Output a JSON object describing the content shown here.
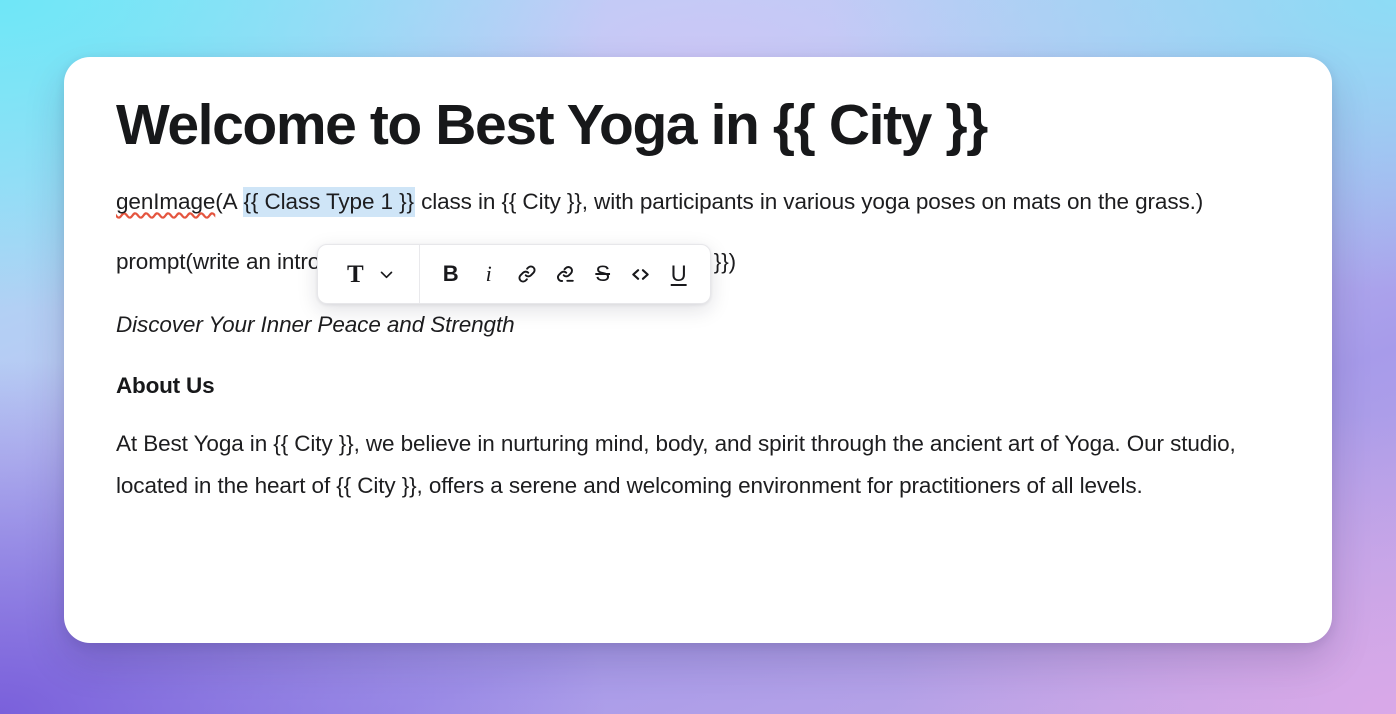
{
  "background": {
    "gradient_colors": [
      "#6fe6f7",
      "#8ddcf5",
      "#cbc7f6",
      "#7a60db",
      "#d9a8e8"
    ]
  },
  "document": {
    "title": "Welcome to Best Yoga in {{ City }}",
    "gen_image_line": {
      "misspelled_word": "genImage",
      "before_selection": "(A ",
      "selected_text": "{{ Class Type 1 }}",
      "after_selection": " class in {{ City }}, with participants in various yoga poses on mats on the grass.)"
    },
    "prompt_line": "prompt(write an introduction about the yoga culture in {{ City }})",
    "tagline": "Discover Your Inner Peace and Strength",
    "about_heading": "About Us",
    "about_body": "At Best Yoga in {{ City }}, we believe in nurturing mind, body, and spirit through the ancient art of Yoga. Our studio, located in the heart of {{ City }}, offers a serene and welcoming environment for practitioners of all levels."
  },
  "toolbar": {
    "text_style_label": "T",
    "dropdown_icon": "chevron-down-icon",
    "buttons": [
      {
        "name": "bold-button",
        "icon": "bold-icon",
        "label": "B"
      },
      {
        "name": "italic-button",
        "icon": "italic-icon",
        "label": "i"
      },
      {
        "name": "link-button",
        "icon": "link-icon",
        "label": ""
      },
      {
        "name": "unlink-button",
        "icon": "link-off-icon",
        "label": ""
      },
      {
        "name": "strikethrough-button",
        "icon": "strikethrough-icon",
        "label": "S"
      },
      {
        "name": "code-button",
        "icon": "code-icon",
        "label": "<>"
      },
      {
        "name": "underline-button",
        "icon": "underline-icon",
        "label": "U"
      }
    ]
  },
  "colors": {
    "card_background": "#ffffff",
    "text": "#17181a",
    "selection_highlight": "#cfe5f7",
    "spellcheck_underline": "#e4553f"
  }
}
